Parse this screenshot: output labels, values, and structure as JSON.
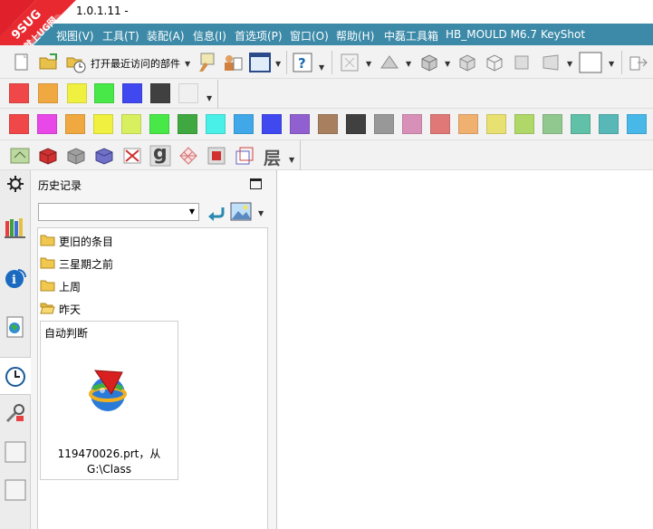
{
  "window": {
    "title": "1.0.1.11 -",
    "logo_text": "9SUG",
    "logo_subtext": "学UG就上UG网"
  },
  "menu": [
    {
      "label": "视图(V)"
    },
    {
      "label": "工具(T)"
    },
    {
      "label": "装配(A)"
    },
    {
      "label": "信息(I)"
    },
    {
      "label": "首选项(P)"
    },
    {
      "label": "窗口(O)"
    },
    {
      "label": "帮助(H)"
    },
    {
      "label": "中磊工具箱"
    },
    {
      "label": "HB_MOULD M6.7"
    },
    {
      "label": "KeyShot"
    }
  ],
  "toolbar": {
    "open_recent_label": "打开最近访问的部件"
  },
  "colors": {
    "menubar": "#3c8aa8",
    "palette_row1": [
      "#f04848",
      "#f0a840",
      "#f0f040",
      "#48e848",
      "#4048f0",
      "#404040",
      "#f0f0f0"
    ],
    "palette_row2": [
      "#f04848",
      "#e848e8",
      "#f0a840",
      "#f0f040",
      "#d8f060",
      "#48e848",
      "#40a840",
      "#48f0e8",
      "#40a8e8",
      "#4048f0",
      "#9060d0",
      "#a88060",
      "#404040",
      "#989898",
      "#d890b8",
      "#e07878",
      "#f0b070",
      "#e8e070",
      "#b0d868",
      "#90c890",
      "#60c0a8",
      "#58b8b8",
      "#48b8e8"
    ]
  },
  "resource_bar": {
    "icons": [
      "gear-icon",
      "library-icon",
      "info-icon",
      "web-icon",
      "history-clock-icon",
      "tools-icon",
      "blank-panel-icon",
      "blank-panel-icon"
    ]
  },
  "history_panel": {
    "title": "历史记录",
    "combo_value": "",
    "groups": [
      {
        "label": "更旧的条目"
      },
      {
        "label": "三星期之前"
      },
      {
        "label": "上周"
      },
      {
        "label": "昨天"
      }
    ],
    "today_group": "自动判断",
    "file_name": "119470026.prt，从",
    "file_path": "G:\\Class"
  },
  "layer_button_label": "层",
  "g_button_label": "g"
}
